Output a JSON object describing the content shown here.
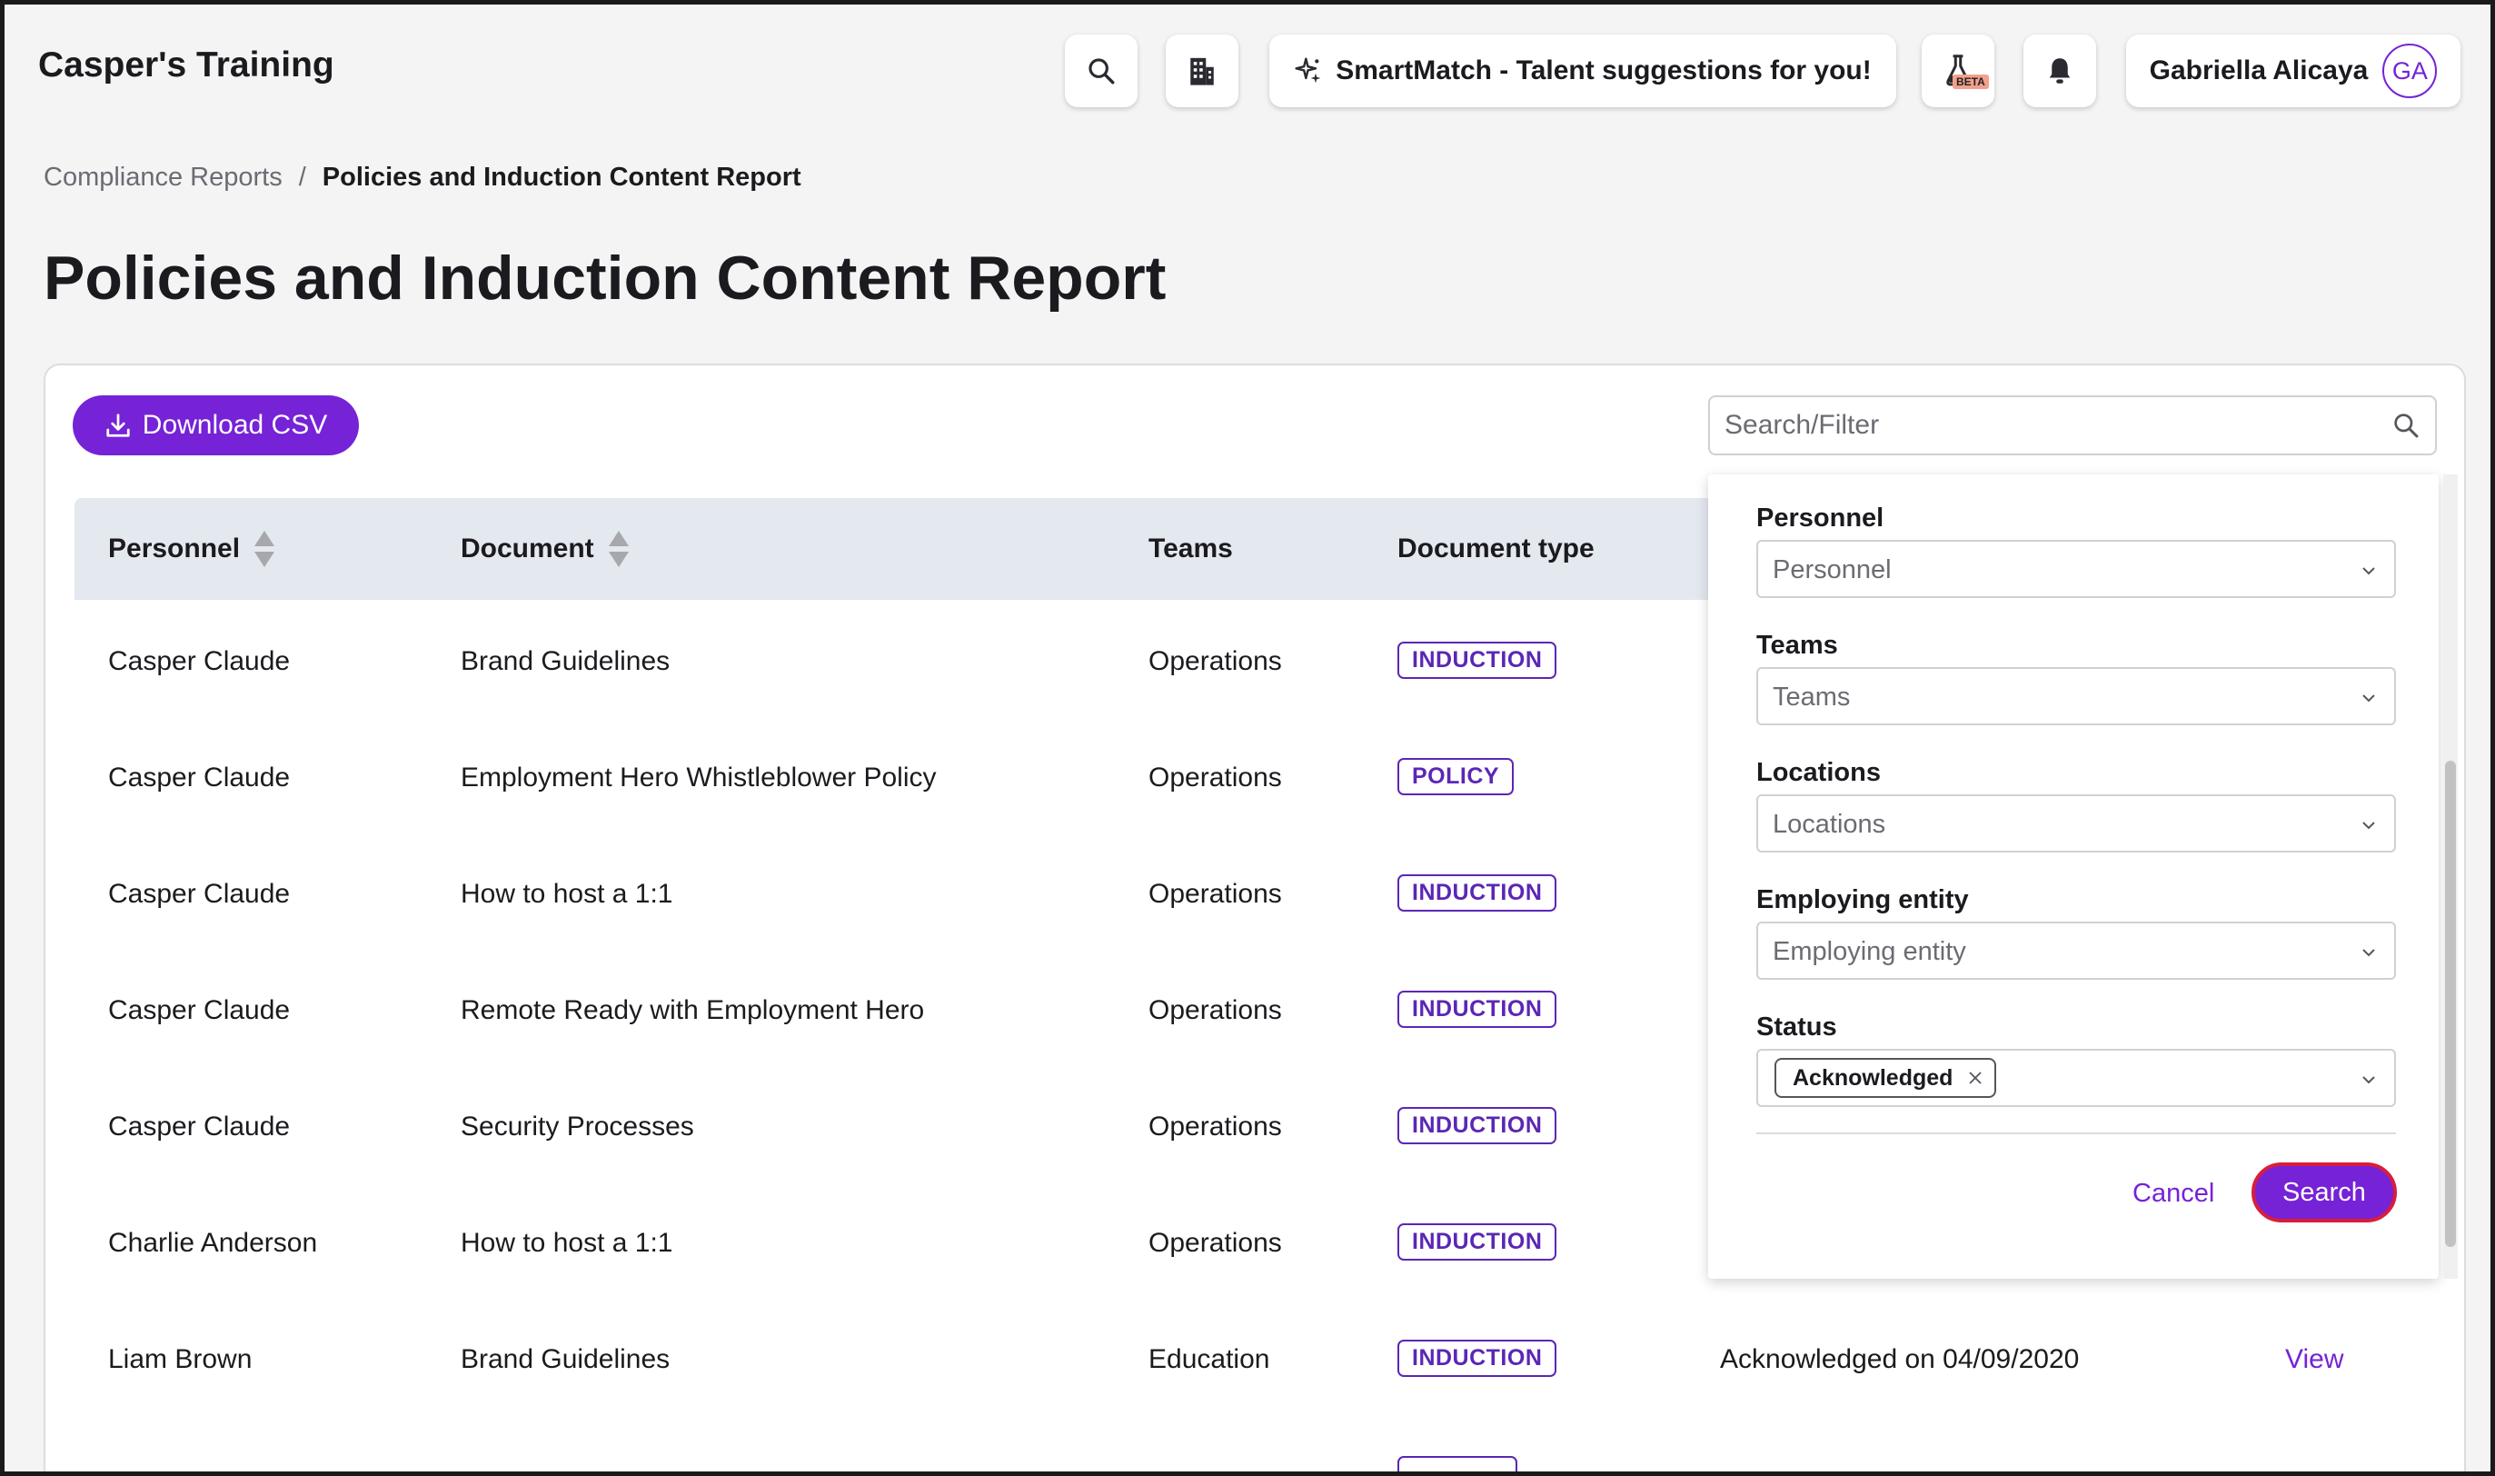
{
  "header": {
    "app_title": "Casper's Training",
    "smartmatch_label": "SmartMatch - Talent suggestions for you!",
    "beta_badge": "BETA",
    "user_name": "Gabriella Alicaya",
    "user_initials": "GA",
    "icons": [
      "search-icon",
      "building-icon",
      "sparkle-icon",
      "flask-icon",
      "bell-icon"
    ]
  },
  "breadcrumb": {
    "parent": "Compliance Reports",
    "separator": "/",
    "current": "Policies and Induction Content Report"
  },
  "page_title": "Policies and Induction Content Report",
  "toolbar": {
    "download_label": "Download CSV",
    "search_placeholder": "Search/Filter"
  },
  "table": {
    "columns": [
      "Personnel",
      "Document",
      "Teams",
      "Document type"
    ],
    "rows": [
      {
        "personnel": "Casper Claude",
        "document": "Brand Guidelines",
        "team": "Operations",
        "type": "INDUCTION",
        "status": "",
        "action": ""
      },
      {
        "personnel": "Casper Claude",
        "document": "Employment Hero Whistleblower Policy",
        "team": "Operations",
        "type": "POLICY",
        "status": "",
        "action": ""
      },
      {
        "personnel": "Casper Claude",
        "document": "How to host a 1:1",
        "team": "Operations",
        "type": "INDUCTION",
        "status": "",
        "action": ""
      },
      {
        "personnel": "Casper Claude",
        "document": "Remote Ready with Employment Hero",
        "team": "Operations",
        "type": "INDUCTION",
        "status": "",
        "action": ""
      },
      {
        "personnel": "Casper Claude",
        "document": "Security Processes",
        "team": "Operations",
        "type": "INDUCTION",
        "status": "",
        "action": ""
      },
      {
        "personnel": "Charlie Anderson",
        "document": "How to host a 1:1",
        "team": "Operations",
        "type": "INDUCTION",
        "status": "",
        "action": ""
      },
      {
        "personnel": "Liam Brown",
        "document": "Brand Guidelines",
        "team": "Education",
        "type": "INDUCTION",
        "status": "Acknowledged on 04/09/2020",
        "action": "View"
      }
    ]
  },
  "filter_panel": {
    "fields": [
      {
        "label": "Personnel",
        "placeholder": "Personnel"
      },
      {
        "label": "Teams",
        "placeholder": "Teams"
      },
      {
        "label": "Locations",
        "placeholder": "Locations"
      },
      {
        "label": "Employing entity",
        "placeholder": "Employing entity"
      }
    ],
    "status": {
      "label": "Status",
      "selected_tag": "Acknowledged"
    },
    "cancel_label": "Cancel",
    "search_label": "Search"
  },
  "colors": {
    "accent": "#7622d7",
    "badge": "#5b27b5",
    "focus_ring": "#d81e3a",
    "header_row": "#e4e8ef",
    "page_bg": "#f4f4f4"
  }
}
